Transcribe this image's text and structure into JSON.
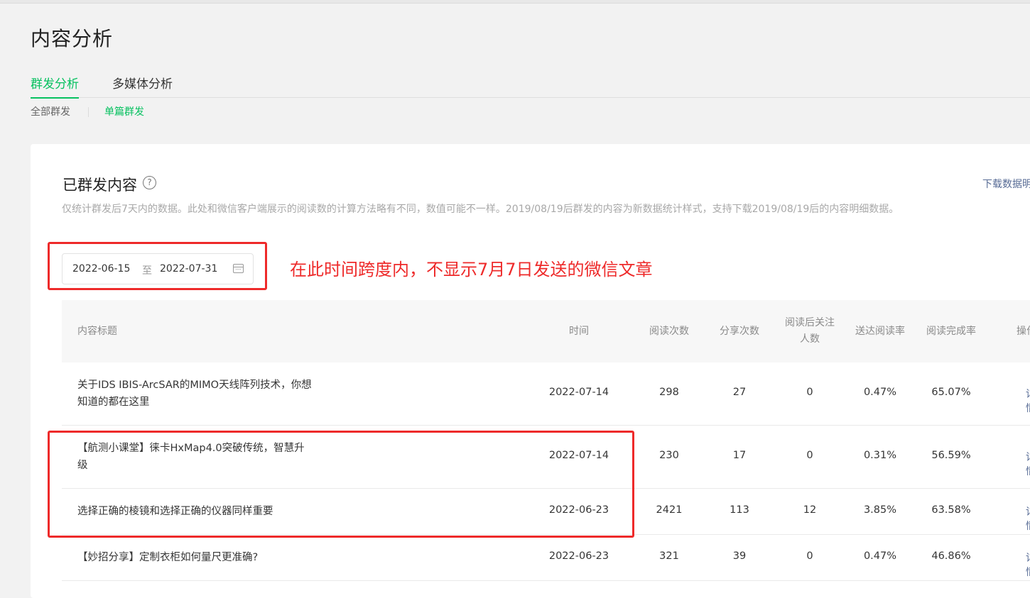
{
  "page_title": "内容分析",
  "tabs": [
    {
      "label": "群发分析",
      "active": true
    },
    {
      "label": "多媒体分析",
      "active": false
    }
  ],
  "subtabs": [
    {
      "label": "全部群发",
      "active": false
    },
    {
      "label": "单篇群发",
      "active": true
    }
  ],
  "section": {
    "title": "已群发内容",
    "help_icon": "?",
    "download_label": "下载数据明细",
    "description": "仅统计群发后7天内的数据。此处和微信客户端展示的阅读数的计算方法略有不同，数值可能不一样。2019/08/19后群发的内容为新数据统计样式，支持下载2019/08/19后的内容明细数据。"
  },
  "date_range": {
    "start": "2022-06-15",
    "separator": "至",
    "end": "2022-07-31",
    "icon": "calendar-icon"
  },
  "annotation": {
    "text": "在此时间跨度内，不显示7月7日发送的微信文章",
    "color": "#ee2a2a"
  },
  "table": {
    "headers": {
      "title": "内容标题",
      "time": "时间",
      "reads": "阅读次数",
      "shares": "分享次数",
      "follows": "阅读后关注人数",
      "reach_rate": "送达阅读率",
      "completion_rate": "阅读完成率",
      "actions": "操作"
    },
    "rows": [
      {
        "title": "关于IDS IBIS-ArcSAR的MIMO天线阵列技术，你想知道的都在这里",
        "time": "2022-07-14",
        "reads": "298",
        "shares": "27",
        "follows": "0",
        "reach_rate": "0.47%",
        "completion_rate": "65.07%",
        "action": "详情"
      },
      {
        "title": "【航测小课堂】徕卡HxMap4.0突破传统，智慧升级",
        "time": "2022-07-14",
        "reads": "230",
        "shares": "17",
        "follows": "0",
        "reach_rate": "0.31%",
        "completion_rate": "56.59%",
        "action": "详情"
      },
      {
        "title": "选择正确的棱镜和选择正确的仪器同样重要",
        "time": "2022-06-23",
        "reads": "2421",
        "shares": "113",
        "follows": "12",
        "reach_rate": "3.85%",
        "completion_rate": "63.58%",
        "action": "详情"
      },
      {
        "title": "【妙招分享】定制衣柜如何量尺更准确?",
        "time": "2022-06-23",
        "reads": "321",
        "shares": "39",
        "follows": "0",
        "reach_rate": "0.47%",
        "completion_rate": "46.86%",
        "action": "详情"
      }
    ]
  },
  "colors": {
    "accent": "#07c160",
    "link": "#576b95",
    "annotation": "#ee2a2a"
  }
}
